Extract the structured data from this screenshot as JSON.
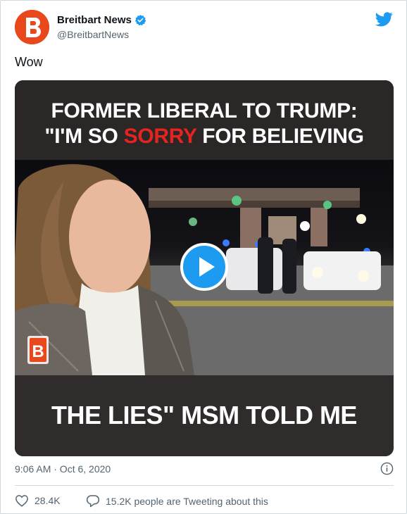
{
  "tweet": {
    "author_name": "Breitbart News",
    "author_handle": "@BreitbartNews",
    "text": "Wow",
    "timestamp": "9:06 AM · Oct 6, 2020",
    "likes": "28.4K",
    "tweeting_about": "15.2K people are Tweeting about this"
  },
  "video": {
    "caption_line1": "FORMER LIBERAL TO TRUMP:",
    "caption_line2_a": "\"I'M SO ",
    "caption_line2_b": "SORRY",
    "caption_line2_c": " FOR BELIEVING",
    "caption_bottom": "THE LIES\" MSM TOLD ME"
  },
  "colors": {
    "brand_orange": "#e8481c",
    "twitter_blue": "#1d9bf0",
    "caption_red": "#e52420"
  },
  "icons": [
    "avatar-logo-icon",
    "verified-icon",
    "twitter-bird-icon",
    "play-icon",
    "breitbart-badge-icon",
    "info-icon",
    "heart-icon",
    "reply-icon"
  ]
}
